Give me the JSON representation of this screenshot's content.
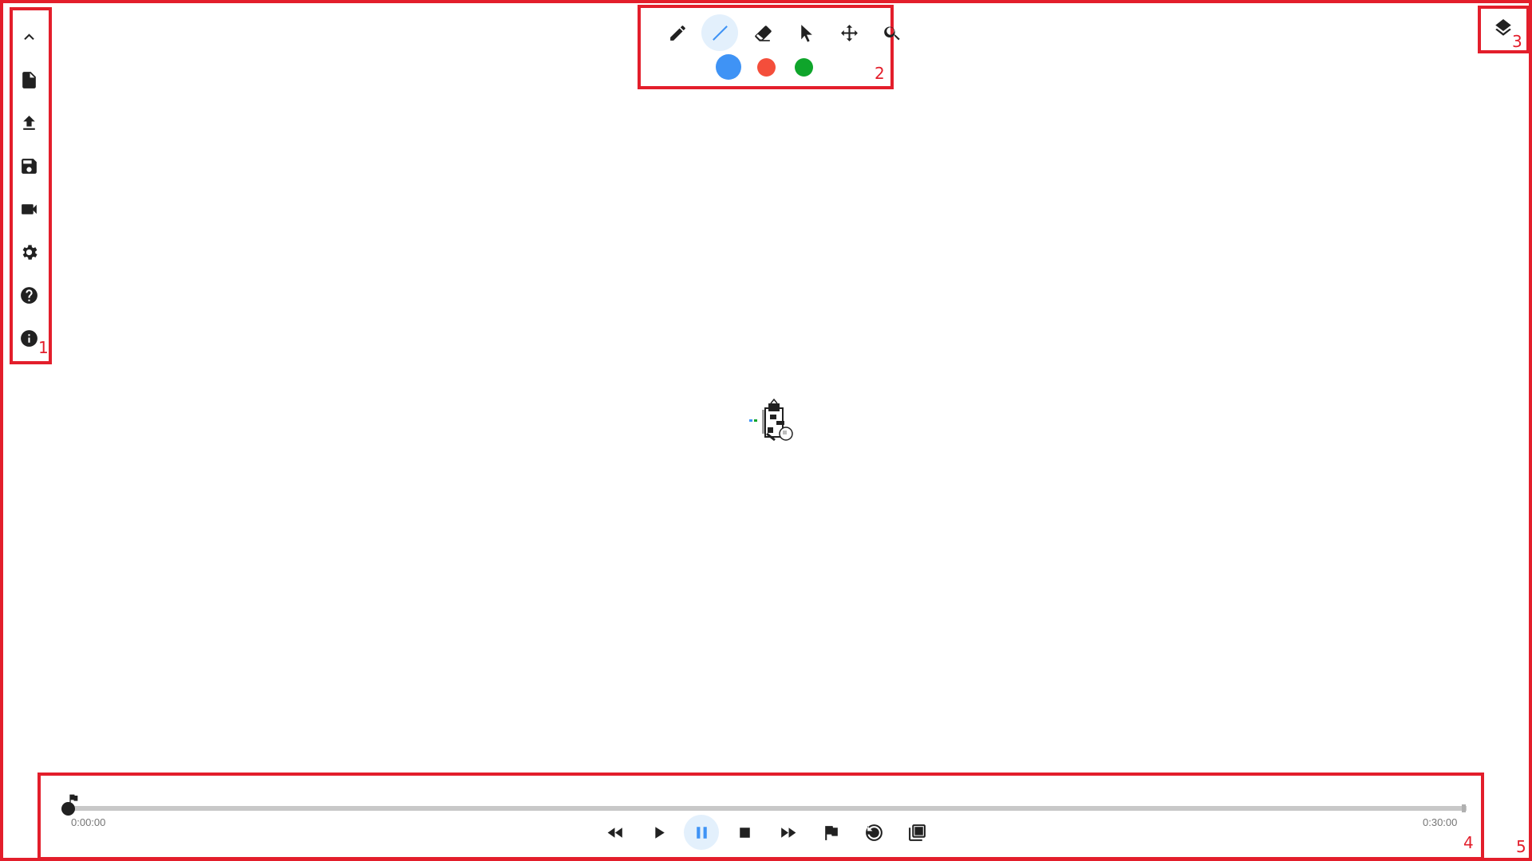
{
  "sidebar": {
    "items": [
      {
        "name": "collapse",
        "icon": "chevron-up-icon"
      },
      {
        "name": "new-file",
        "icon": "file-icon"
      },
      {
        "name": "upload",
        "icon": "upload-icon"
      },
      {
        "name": "save",
        "icon": "save-icon"
      },
      {
        "name": "record",
        "icon": "video-camera-icon"
      },
      {
        "name": "settings",
        "icon": "gear-icon"
      },
      {
        "name": "help",
        "icon": "help-icon"
      },
      {
        "name": "info",
        "icon": "info-icon"
      }
    ]
  },
  "toolbar": {
    "tools": [
      {
        "name": "pencil",
        "icon": "pencil-icon",
        "active": false
      },
      {
        "name": "line",
        "icon": "line-icon",
        "active": true
      },
      {
        "name": "eraser",
        "icon": "eraser-icon",
        "active": false
      },
      {
        "name": "select",
        "icon": "cursor-icon",
        "active": false
      },
      {
        "name": "move",
        "icon": "move-icon",
        "active": false
      },
      {
        "name": "zoom",
        "icon": "magnifier-icon",
        "active": false
      }
    ],
    "colors": [
      {
        "name": "blue",
        "hex": "#3f93f5",
        "selected": true
      },
      {
        "name": "red",
        "hex": "#f44e3b",
        "selected": false
      },
      {
        "name": "green",
        "hex": "#0fa52b",
        "selected": false
      }
    ]
  },
  "layers": {
    "icon": "layers-icon"
  },
  "playback": {
    "current_time": "0:00:00",
    "end_time": "0:30:00",
    "progress": 0,
    "controls": [
      {
        "name": "rewind",
        "icon": "rewind-icon",
        "active": false
      },
      {
        "name": "play",
        "icon": "play-icon",
        "active": false
      },
      {
        "name": "pause",
        "icon": "pause-icon",
        "active": true
      },
      {
        "name": "stop",
        "icon": "stop-icon",
        "active": false
      },
      {
        "name": "fast-forward",
        "icon": "fast-forward-icon",
        "active": false
      },
      {
        "name": "add-marker",
        "icon": "flag-icon",
        "active": false
      },
      {
        "name": "replay",
        "icon": "replay-icon",
        "active": false
      },
      {
        "name": "copy-frames",
        "icon": "copy-icon",
        "active": false
      }
    ]
  },
  "annotations": [
    "1",
    "2",
    "3",
    "4",
    "5"
  ],
  "accent_color": "#e31e2b"
}
